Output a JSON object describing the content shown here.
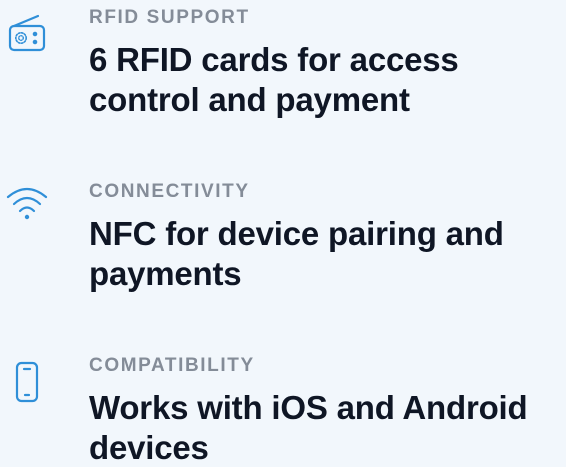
{
  "features": [
    {
      "kicker": "RFID SUPPORT",
      "title": "6 RFID cards for access control and payment",
      "icon": "radio-icon"
    },
    {
      "kicker": "CONNECTIVITY",
      "title": "NFC for device pairing and payments",
      "icon": "wifi-icon"
    },
    {
      "kicker": "COMPATIBILITY",
      "title": "Works with iOS and Android devices",
      "icon": "smartphone-icon"
    }
  ],
  "colors": {
    "background": "#f2f7fc",
    "accent": "#2f8fd8",
    "kicker": "#848c98",
    "title": "#0f1625"
  }
}
